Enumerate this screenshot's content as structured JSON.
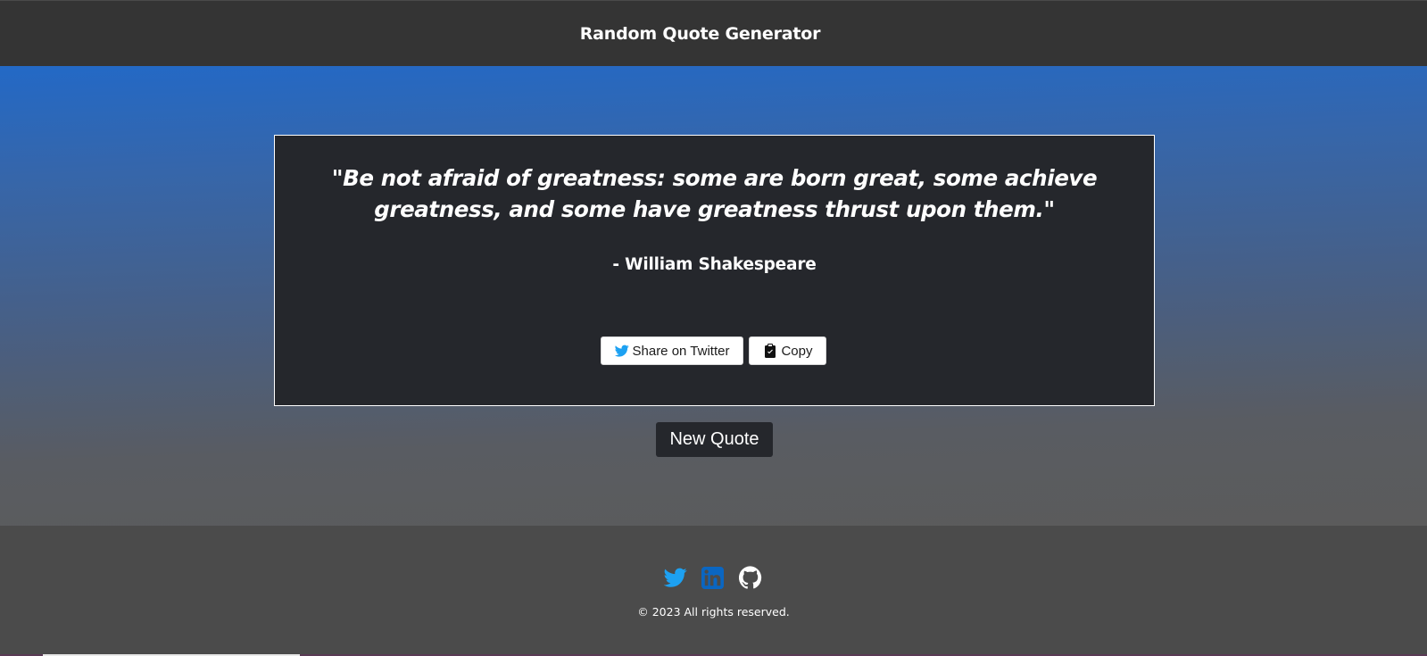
{
  "header": {
    "title": "Random Quote Generator"
  },
  "quote": {
    "text": "\"Be not afraid of greatness: some are born great, some achieve greatness, and some have greatness thrust upon them.\"",
    "author": "- William Shakespeare"
  },
  "actions": {
    "share_label": "Share on Twitter",
    "share_icon": "twitter-icon",
    "copy_label": "Copy",
    "copy_icon": "clipboard-check-icon",
    "new_quote_label": "New Quote"
  },
  "footer": {
    "social": [
      {
        "icon": "twitter-icon",
        "color": "#1da1f2"
      },
      {
        "icon": "linkedin-icon",
        "color": "#0a66c2"
      },
      {
        "icon": "github-icon",
        "color": "#ffffff"
      }
    ],
    "copyright": "© 2023 All rights reserved."
  },
  "colors": {
    "header_bg": "#343434",
    "card_bg": "#25272c",
    "gradient_top": "#2369c6",
    "gradient_bottom": "#5b5b5b",
    "footer_bg": "#4b4b4b"
  }
}
